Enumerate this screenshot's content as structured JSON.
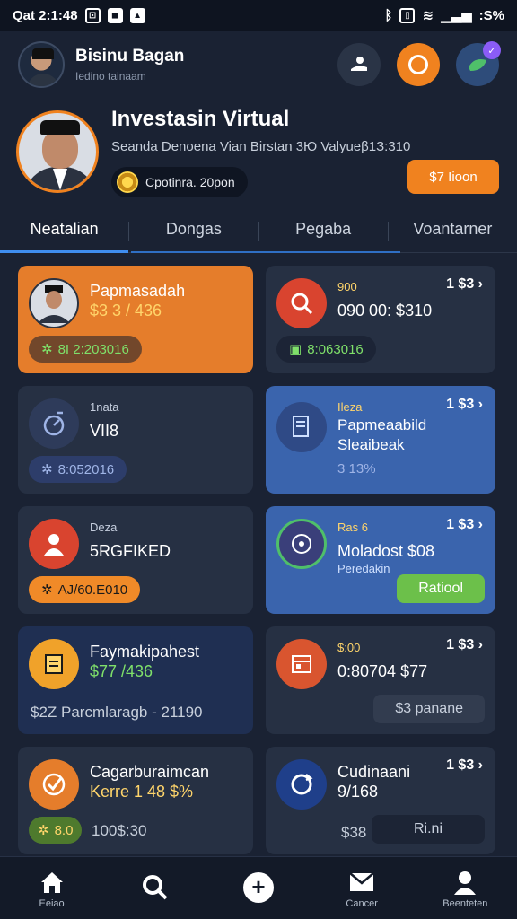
{
  "status_bar": {
    "time": "Qat 2:1:48",
    "battery": ":S%"
  },
  "header": {
    "name": "Bisinu Bagan",
    "subtitle": "Iedino tainaam"
  },
  "header_actions": {
    "badge": "✓"
  },
  "profile": {
    "title": "Investasin Virtual",
    "description": "Seanda Denoena Vian Birstan 3Ю Valyueβ1З:310",
    "coins": "Cpotinra. 20pon",
    "cta_label": "$7 Iioon"
  },
  "tabs": [
    "Neatalian",
    "Dongas",
    "Pegaba",
    "Voantarner"
  ],
  "cards": [
    {
      "title": "Papmasadah",
      "value": "$3 3 / 436",
      "pill": "8I 2:203016"
    },
    {
      "small": "900",
      "value": "090 00: $310",
      "corner": "1 $3 ›",
      "pill": "8:063016"
    },
    {
      "small": "1nata",
      "value": "VII8",
      "pill": "8:052016"
    },
    {
      "small": "Ileza",
      "title": "Papmeaabild",
      "value": "Sleaibeak",
      "extra": "3 13%",
      "corner": "1 $3 ›"
    },
    {
      "small": "Deza",
      "value": "5RGFIKED",
      "pill": "AJ/60.E010"
    },
    {
      "small": "Ras 6",
      "value": "Moladost $08",
      "extra": "Peredakin",
      "corner": "1 $3 ›",
      "button": "Ratiool"
    },
    {
      "title": "Faymakipahest",
      "value": "$77 /436",
      "bottom": "$2Z  Parcmlaragb - 21190"
    },
    {
      "small": "$:00",
      "value": "0:80704 $77",
      "corner": "1 $3 ›",
      "button": "$3 panane"
    },
    {
      "title": "Cagarburaimcan",
      "value": "Kerre 1 48 $%",
      "pill": "8.0",
      "bottom": "100$:30"
    },
    {
      "title": "Cudinaani",
      "value": "9/168",
      "corner": "1 $3 ›",
      "bottom": "$38",
      "button": "Ri.ni"
    }
  ],
  "bottom_nav": [
    {
      "label": "Eeiao",
      "icon": "home-icon"
    },
    {
      "label": "",
      "icon": "search-icon"
    },
    {
      "label": "",
      "icon": "plus-icon"
    },
    {
      "label": "Cancer",
      "icon": "mail-icon"
    },
    {
      "label": "Beenteten",
      "icon": "user-icon"
    }
  ]
}
